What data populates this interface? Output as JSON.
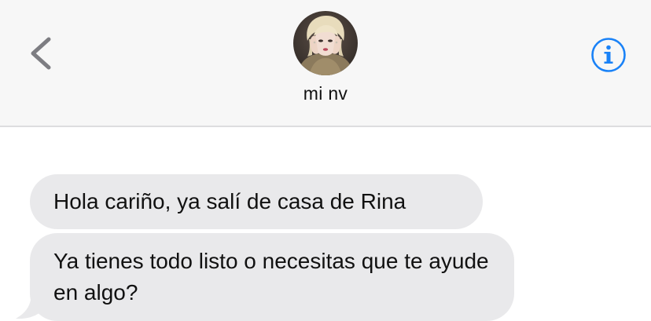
{
  "header": {
    "contact_name": "mi nv",
    "back_icon": "chevron-left-icon",
    "info_icon": "info-circle-icon",
    "avatar_icon": "contact-avatar",
    "accent_color": "#1a82f7",
    "back_color": "#7d7d82"
  },
  "messages": [
    {
      "direction": "incoming",
      "text": "Hola cariño, ya salí de casa de Rina"
    },
    {
      "direction": "incoming",
      "text": "Ya tienes todo listo o necesitas que te ayude en algo?"
    }
  ],
  "colors": {
    "incoming_bubble": "#e9e9eb",
    "header_bg": "#f7f7f7",
    "thread_bg": "#ffffff"
  }
}
